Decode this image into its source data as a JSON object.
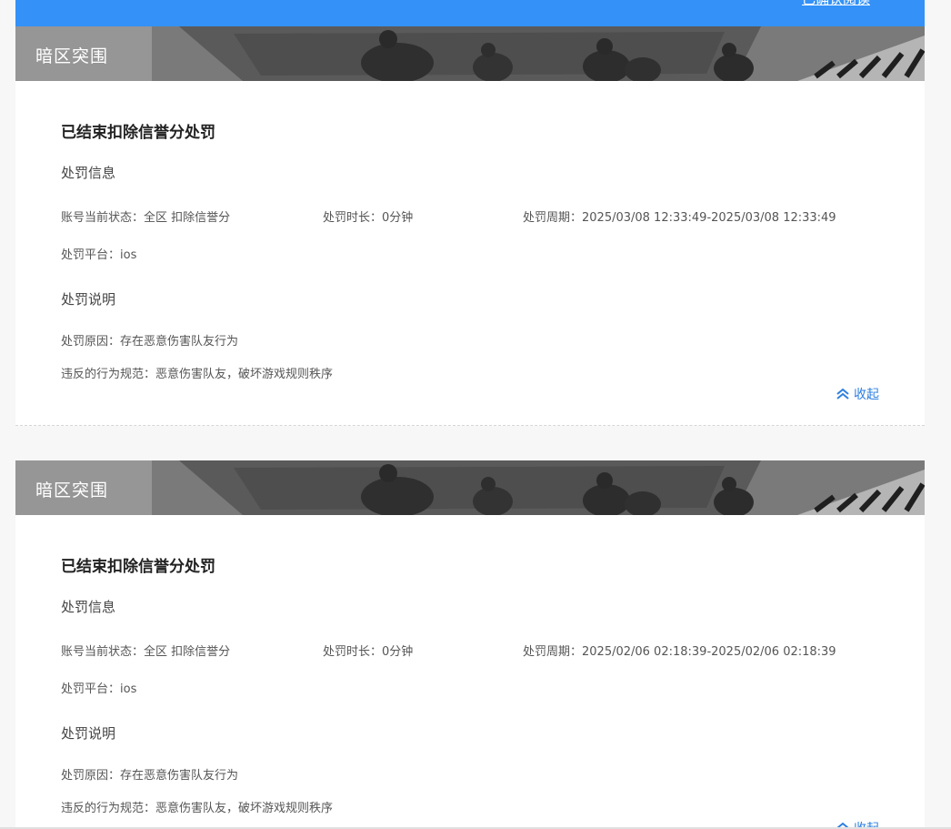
{
  "header": {
    "link_label": "已确认阅读"
  },
  "records": [
    {
      "game": "暗区突围",
      "status_title": "已结束扣除信誉分处罚",
      "info_section": "处罚信息",
      "account_status": "账号当前状态：全区 扣除信誉分",
      "duration": "处罚时长：0分钟",
      "period": "处罚周期：2025/03/08 12:33:49-2025/03/08 12:33:49",
      "platform": "处罚平台：ios",
      "desc_section": "处罚说明",
      "reason": "处罚原因：存在恶意伤害队友行为",
      "violation": "违反的行为规范：恶意伤害队友，破坏游戏规则秩序",
      "collapse_label": "收起"
    },
    {
      "game": "暗区突围",
      "status_title": "已结束扣除信誉分处罚",
      "info_section": "处罚信息",
      "account_status": "账号当前状态：全区 扣除信誉分",
      "duration": "处罚时长：0分钟",
      "period": "处罚周期：2025/02/06 02:18:39-2025/02/06 02:18:39",
      "platform": "处罚平台：ios",
      "desc_section": "处罚说明",
      "reason": "处罚原因：存在恶意伤害队友行为",
      "violation": "违反的行为规范：恶意伤害队友，破坏游戏规则秩序",
      "collapse_label": "收起"
    }
  ],
  "colors": {
    "header_blue": "#3391f7",
    "link_blue": "#2d7fe0"
  }
}
